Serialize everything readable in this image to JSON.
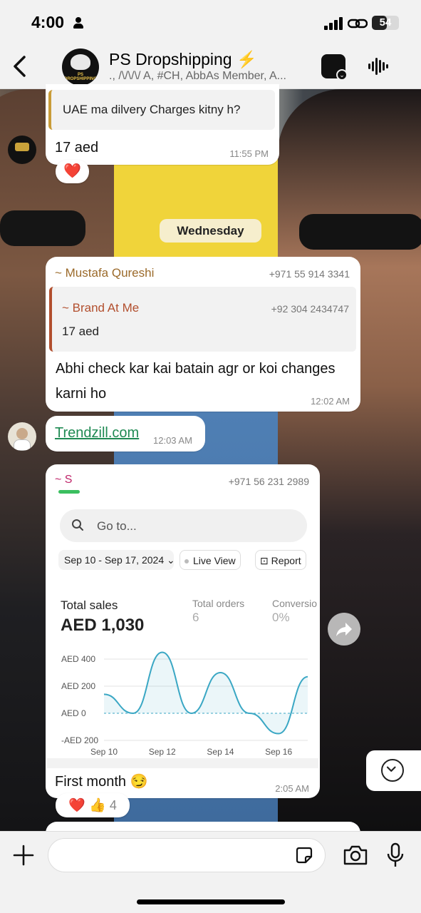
{
  "status": {
    "time": "4:00",
    "battery": "54",
    "battery_level": 0.54
  },
  "header": {
    "group_name": "PS Dropshipping",
    "group_emoji": "⚡",
    "members": "., /\\/\\/\\/ A, #CH, AbbAs Member, A...",
    "avatar_label": "PS DROPSHIPPING"
  },
  "messages": {
    "m1": {
      "quote_text": "UAE ma dilvery Charges kitny h?",
      "text": "17 aed",
      "time": "11:55 PM",
      "reaction": "❤️"
    },
    "date_divider": "Wednesday",
    "m2": {
      "sender": "~ Mustafa Qureshi",
      "sender_color": "#9b6a2a",
      "phone": "+971 55 914 3341",
      "quote_sender": "~ Brand At Me",
      "quote_sender_color": "#b24f2e",
      "quote_phone": "+92 304 2434747",
      "quote_text": "17 aed",
      "text_line1": "Abhi check kar kai batain agr or koi changes",
      "text_line2": "karni ho",
      "time": "12:02 AM"
    },
    "m3": {
      "link": "Trendzill.com",
      "time": "12:03 AM"
    },
    "m4": {
      "sender": "~ S",
      "sender_color": "#c0266a",
      "phone": "+971 56 231 2989",
      "screenshot": {
        "search_placeholder": "Go to...",
        "date_range": "Sep 10 - Sep 17, 2024",
        "live_view": "Live View",
        "report": "Report",
        "total_sales_label": "Total sales",
        "total_sales_value": "AED 1,030",
        "total_orders_label": "Total orders",
        "total_orders_value": "6",
        "conversion_label": "Conversio",
        "conversion_value": "0%"
      },
      "text": "First month 😏",
      "time": "2:05 AM",
      "reactions": "❤️ 👍",
      "reaction_count": "4"
    }
  },
  "chart_data": {
    "type": "line",
    "x": [
      "Sep 10",
      "Sep 11",
      "Sep 12",
      "Sep 13",
      "Sep 14",
      "Sep 15",
      "Sep 16",
      "Sep 17"
    ],
    "series": [
      {
        "values": [
          140,
          0,
          450,
          0,
          300,
          0,
          -150,
          270
        ]
      }
    ],
    "x_tick_labels": [
      "Sep 10",
      "Sep 12",
      "Sep 14",
      "Sep 16"
    ],
    "y_tick_labels": [
      "AED 400",
      "AED 200",
      "AED 0",
      "-AED 200"
    ],
    "ylim": [
      -200,
      400
    ],
    "color": "#3aa7c4",
    "grid": true
  },
  "colors": {
    "accent": "#1f8a53",
    "reaction_heart": "#e0202a",
    "date_pill": "#f6eecd"
  }
}
